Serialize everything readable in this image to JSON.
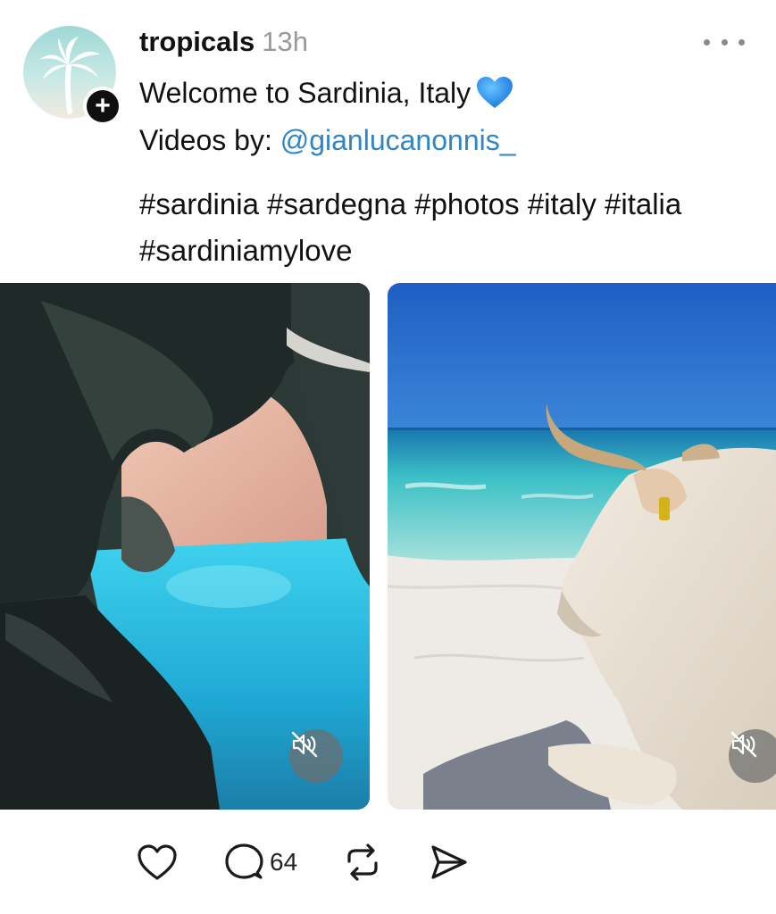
{
  "post": {
    "username": "tropicals",
    "timestamp": "13h",
    "caption_line1": "Welcome to Sardinia, Italy",
    "caption_line2_prefix": "Videos by: ",
    "mention": "@gianlucanonnis_",
    "hashtags_line1": "#sardinia #sardegna #photos #italy #italia",
    "hashtags_line2": "#sardiniamylove",
    "emoji": "blue-heart"
  },
  "media": [
    {
      "type": "video",
      "subject": "sea cave with turquoise water",
      "muted": true
    },
    {
      "type": "video",
      "subject": "white cow lying on sandy beach",
      "muted": true
    }
  ],
  "actions": {
    "like_icon": "heart-icon",
    "reply_icon": "comment-icon",
    "reply_count": "64",
    "repost_icon": "repost-icon",
    "share_icon": "send-icon"
  },
  "colors": {
    "mention": "#2e86c9",
    "timestamp": "#9a9a9a",
    "text": "#111111"
  }
}
